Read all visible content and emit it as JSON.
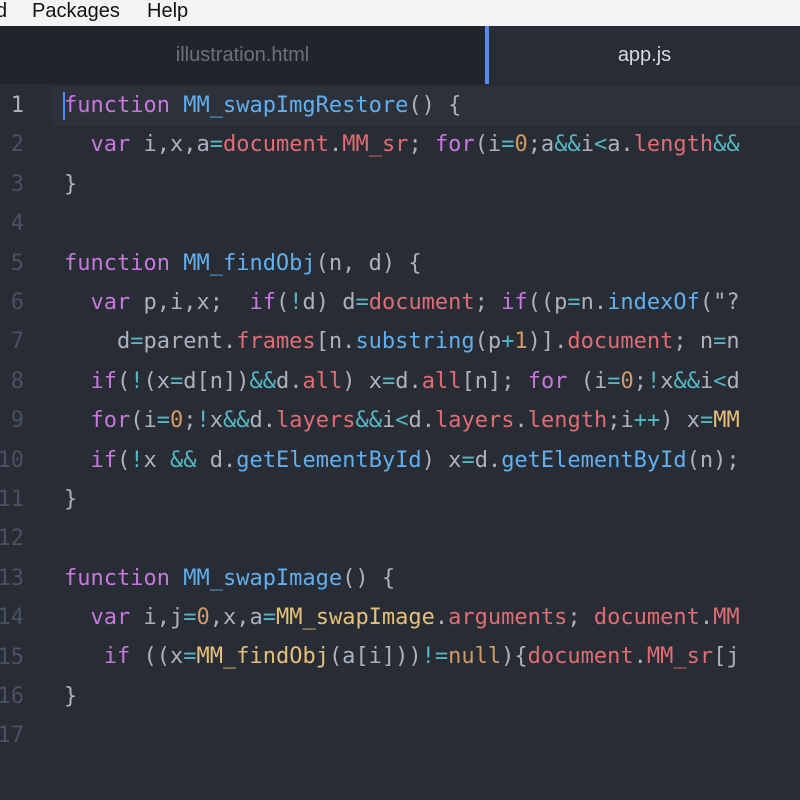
{
  "menu": {
    "items": [
      "d",
      "Packages",
      "Help"
    ]
  },
  "tabs": [
    {
      "label": "illustration.html",
      "active": false
    },
    {
      "label": "app.js",
      "active": true
    }
  ],
  "gutter": {
    "line_numbers": [
      "1",
      "2",
      "3",
      "4",
      "5",
      "6",
      "7",
      "8",
      "9",
      "10",
      "11",
      "12",
      "13",
      "14",
      "15",
      "16",
      "17"
    ]
  },
  "code": {
    "lines": [
      [
        [
          "k",
          "function"
        ],
        [
          "p",
          " "
        ],
        [
          "f",
          "MM_swapImgRestore"
        ],
        [
          "p",
          "() {"
        ]
      ],
      [
        [
          "p",
          "  "
        ],
        [
          "k",
          "var"
        ],
        [
          "p",
          " i,x,a"
        ],
        [
          "o",
          "="
        ],
        [
          "r",
          "document"
        ],
        [
          "p",
          "."
        ],
        [
          "r",
          "MM_sr"
        ],
        [
          "p",
          "; "
        ],
        [
          "k",
          "for"
        ],
        [
          "p",
          "(i"
        ],
        [
          "o",
          "="
        ],
        [
          "n",
          "0"
        ],
        [
          "p",
          ";a"
        ],
        [
          "o",
          "&&"
        ],
        [
          "p",
          "i"
        ],
        [
          "o",
          "<"
        ],
        [
          "p",
          "a."
        ],
        [
          "r",
          "length"
        ],
        [
          "o",
          "&&"
        ]
      ],
      [
        [
          "p",
          "}"
        ]
      ],
      [
        [
          "p",
          ""
        ]
      ],
      [
        [
          "k",
          "function"
        ],
        [
          "p",
          " "
        ],
        [
          "f",
          "MM_findObj"
        ],
        [
          "p",
          "(n, d) {"
        ]
      ],
      [
        [
          "p",
          "  "
        ],
        [
          "k",
          "var"
        ],
        [
          "p",
          " p,i,x;  "
        ],
        [
          "k",
          "if"
        ],
        [
          "p",
          "("
        ],
        [
          "o",
          "!"
        ],
        [
          "p",
          "d) d"
        ],
        [
          "o",
          "="
        ],
        [
          "r",
          "document"
        ],
        [
          "p",
          "; "
        ],
        [
          "k",
          "if"
        ],
        [
          "p",
          "((p"
        ],
        [
          "o",
          "="
        ],
        [
          "p",
          "n."
        ],
        [
          "f",
          "indexOf"
        ],
        [
          "p",
          "(\"?"
        ]
      ],
      [
        [
          "p",
          "    d"
        ],
        [
          "o",
          "="
        ],
        [
          "p",
          "parent."
        ],
        [
          "r",
          "frames"
        ],
        [
          "p",
          "[n."
        ],
        [
          "f",
          "substring"
        ],
        [
          "p",
          "(p"
        ],
        [
          "o",
          "+"
        ],
        [
          "n",
          "1"
        ],
        [
          "p",
          ")]."
        ],
        [
          "r",
          "document"
        ],
        [
          "p",
          "; n"
        ],
        [
          "o",
          "="
        ],
        [
          "p",
          "n"
        ]
      ],
      [
        [
          "p",
          "  "
        ],
        [
          "k",
          "if"
        ],
        [
          "p",
          "("
        ],
        [
          "o",
          "!"
        ],
        [
          "p",
          "(x"
        ],
        [
          "o",
          "="
        ],
        [
          "p",
          "d[n])"
        ],
        [
          "o",
          "&&"
        ],
        [
          "p",
          "d."
        ],
        [
          "r",
          "all"
        ],
        [
          "p",
          ") x"
        ],
        [
          "o",
          "="
        ],
        [
          "p",
          "d."
        ],
        [
          "r",
          "all"
        ],
        [
          "p",
          "[n]; "
        ],
        [
          "k",
          "for"
        ],
        [
          "p",
          " (i"
        ],
        [
          "o",
          "="
        ],
        [
          "n",
          "0"
        ],
        [
          "p",
          ";"
        ],
        [
          "o",
          "!"
        ],
        [
          "p",
          "x"
        ],
        [
          "o",
          "&&"
        ],
        [
          "p",
          "i"
        ],
        [
          "o",
          "<"
        ],
        [
          "p",
          "d"
        ]
      ],
      [
        [
          "p",
          "  "
        ],
        [
          "k",
          "for"
        ],
        [
          "p",
          "(i"
        ],
        [
          "o",
          "="
        ],
        [
          "n",
          "0"
        ],
        [
          "p",
          ";"
        ],
        [
          "o",
          "!"
        ],
        [
          "p",
          "x"
        ],
        [
          "o",
          "&&"
        ],
        [
          "p",
          "d."
        ],
        [
          "r",
          "layers"
        ],
        [
          "o",
          "&&"
        ],
        [
          "p",
          "i"
        ],
        [
          "o",
          "<"
        ],
        [
          "p",
          "d."
        ],
        [
          "r",
          "layers"
        ],
        [
          "p",
          "."
        ],
        [
          "r",
          "length"
        ],
        [
          "p",
          ";i"
        ],
        [
          "o",
          "++"
        ],
        [
          "p",
          ") x"
        ],
        [
          "o",
          "="
        ],
        [
          "y",
          "MM"
        ]
      ],
      [
        [
          "p",
          "  "
        ],
        [
          "k",
          "if"
        ],
        [
          "p",
          "("
        ],
        [
          "o",
          "!"
        ],
        [
          "p",
          "x "
        ],
        [
          "o",
          "&&"
        ],
        [
          "p",
          " d."
        ],
        [
          "f",
          "getElementById"
        ],
        [
          "p",
          ") x"
        ],
        [
          "o",
          "="
        ],
        [
          "p",
          "d."
        ],
        [
          "f",
          "getElementById"
        ],
        [
          "p",
          "(n);"
        ]
      ],
      [
        [
          "p",
          "}"
        ]
      ],
      [
        [
          "p",
          ""
        ]
      ],
      [
        [
          "k",
          "function"
        ],
        [
          "p",
          " "
        ],
        [
          "f",
          "MM_swapImage"
        ],
        [
          "p",
          "() {"
        ]
      ],
      [
        [
          "p",
          "  "
        ],
        [
          "k",
          "var"
        ],
        [
          "p",
          " i,j"
        ],
        [
          "o",
          "="
        ],
        [
          "n",
          "0"
        ],
        [
          "p",
          ",x,a"
        ],
        [
          "o",
          "="
        ],
        [
          "y",
          "MM_swapImage"
        ],
        [
          "p",
          "."
        ],
        [
          "r",
          "arguments"
        ],
        [
          "p",
          "; "
        ],
        [
          "r",
          "document"
        ],
        [
          "p",
          "."
        ],
        [
          "r",
          "MM"
        ]
      ],
      [
        [
          "p",
          "   "
        ],
        [
          "k",
          "if"
        ],
        [
          "p",
          " ((x"
        ],
        [
          "o",
          "="
        ],
        [
          "y",
          "MM_findObj"
        ],
        [
          "p",
          "(a[i]))"
        ],
        [
          "o",
          "!="
        ],
        [
          "n",
          "null"
        ],
        [
          "p",
          "){"
        ],
        [
          "r",
          "document"
        ],
        [
          "p",
          "."
        ],
        [
          "r",
          "MM_sr"
        ],
        [
          "p",
          "[j"
        ]
      ],
      [
        [
          "p",
          "}"
        ]
      ],
      [
        [
          "p",
          ""
        ]
      ]
    ]
  },
  "colors": {
    "background": "#282c34",
    "keyword": "#c678dd",
    "function": "#61afef",
    "property": "#e06c75",
    "operator": "#56b6c2",
    "number": "#d19a66",
    "class": "#e5c07b",
    "cursor": "#528bff"
  }
}
